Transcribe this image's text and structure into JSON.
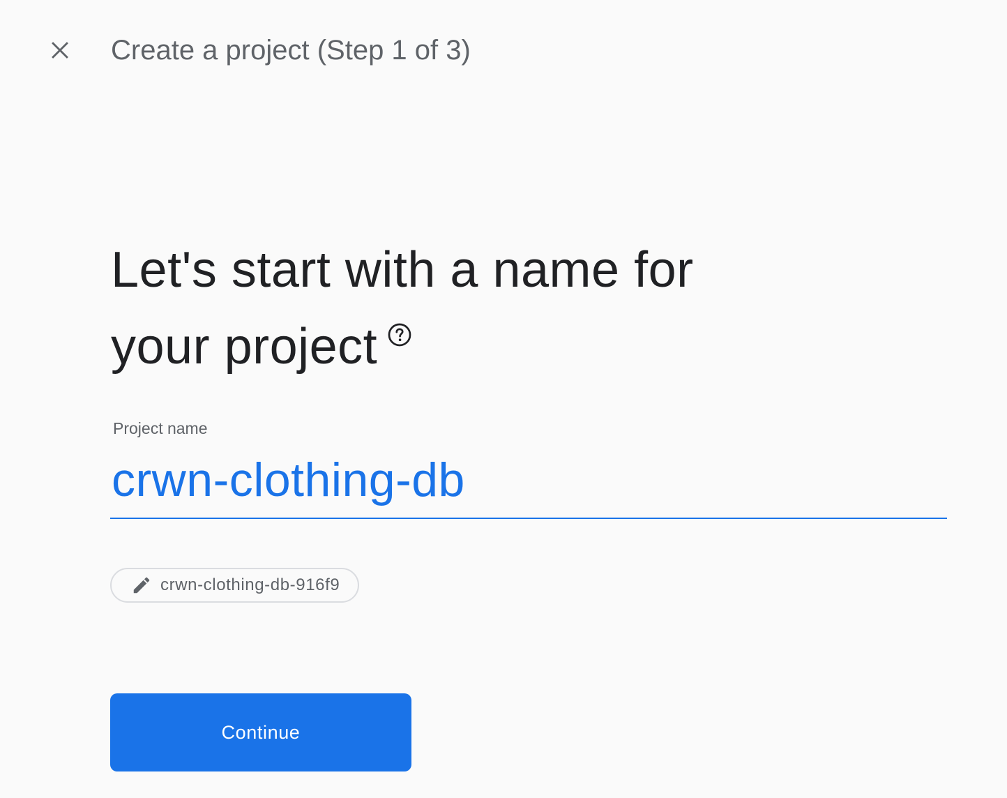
{
  "header": {
    "close_icon": "close-icon",
    "title": "Create a project (Step 1 of 3)"
  },
  "main": {
    "heading_line1": "Let's start with a name for",
    "heading_line2": "your project",
    "help_icon": "help-circle-icon",
    "project_name": {
      "label": "Project name",
      "value": "crwn-clothing-db"
    },
    "project_id": {
      "icon": "pencil-icon",
      "value": "crwn-clothing-db-916f9"
    },
    "continue_label": "Continue"
  },
  "colors": {
    "accent": "#1a73e8",
    "background": "#fafafa",
    "heading_text": "#202124",
    "secondary_text": "#5f6368",
    "chip_border": "#dadce0"
  }
}
